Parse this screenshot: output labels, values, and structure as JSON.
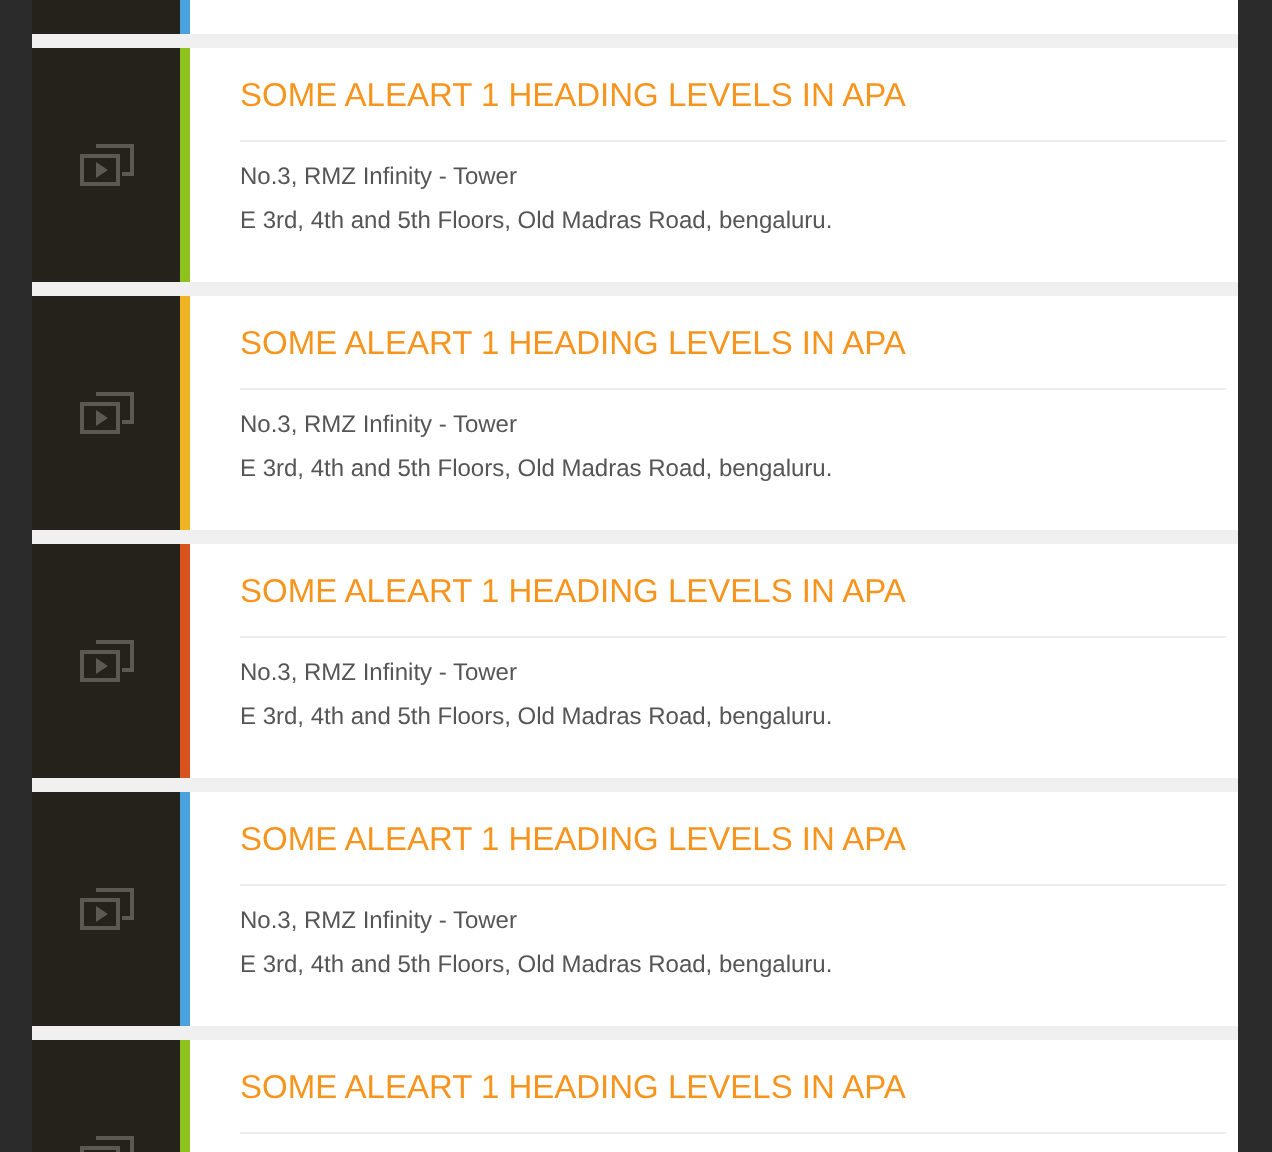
{
  "cards": [
    {
      "color": "#4aa3df"
    },
    {
      "color": "#8dc21f",
      "heading": "SOME ALEART 1 HEADING LEVELS IN APA",
      "address": [
        "No.3, RMZ Infinity - Tower",
        "E 3rd, 4th and 5th Floors, Old Madras Road, bengaluru."
      ]
    },
    {
      "color": "#f0b323",
      "heading": "SOME ALEART 1 HEADING LEVELS IN APA",
      "address": [
        "No.3, RMZ Infinity - Tower",
        "E 3rd, 4th and 5th Floors, Old Madras Road, bengaluru."
      ]
    },
    {
      "color": "#d9531e",
      "heading": "SOME ALEART 1 HEADING LEVELS IN APA",
      "address": [
        "No.3, RMZ Infinity - Tower",
        "E 3rd, 4th and 5th Floors, Old Madras Road, bengaluru."
      ]
    },
    {
      "color": "#4aa3df",
      "heading": "SOME ALEART 1 HEADING LEVELS IN APA",
      "address": [
        "No.3, RMZ Infinity - Tower",
        "E 3rd, 4th and 5th Floors, Old Madras Road, bengaluru."
      ]
    },
    {
      "color": "#8dc21f",
      "heading": "SOME ALEART 1 HEADING LEVELS IN APA"
    }
  ]
}
